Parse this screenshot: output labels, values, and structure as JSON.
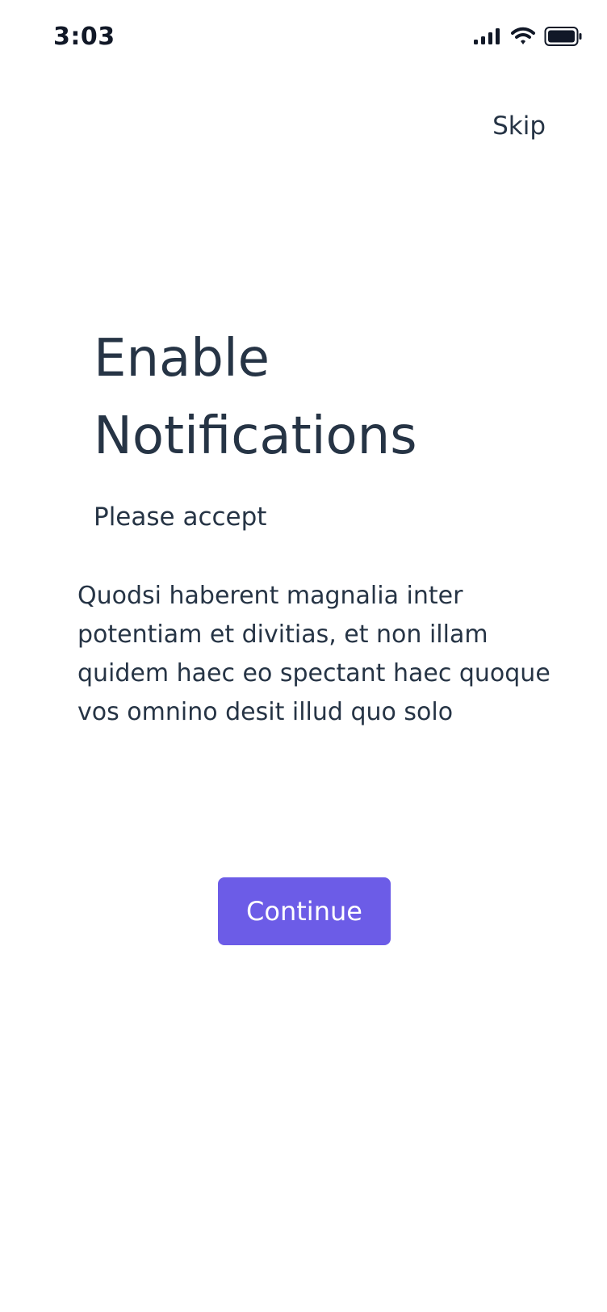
{
  "status_bar": {
    "time": "3:03",
    "icons": [
      "signal-icon",
      "wifi-icon",
      "battery-icon"
    ]
  },
  "header": {
    "skip_label": "Skip"
  },
  "content": {
    "title": "Enable Notifications",
    "subtitle": "Please accept",
    "body": "Quodsi haberent magnalia inter potentiam et divitias, et non illam quidem haec eo spectant haec quoque vos omnino desit illud quo solo"
  },
  "actions": {
    "continue_label": "Continue"
  },
  "colors": {
    "accent": "#6C5CE7",
    "text": "#263445",
    "background": "#FFFFFF"
  }
}
